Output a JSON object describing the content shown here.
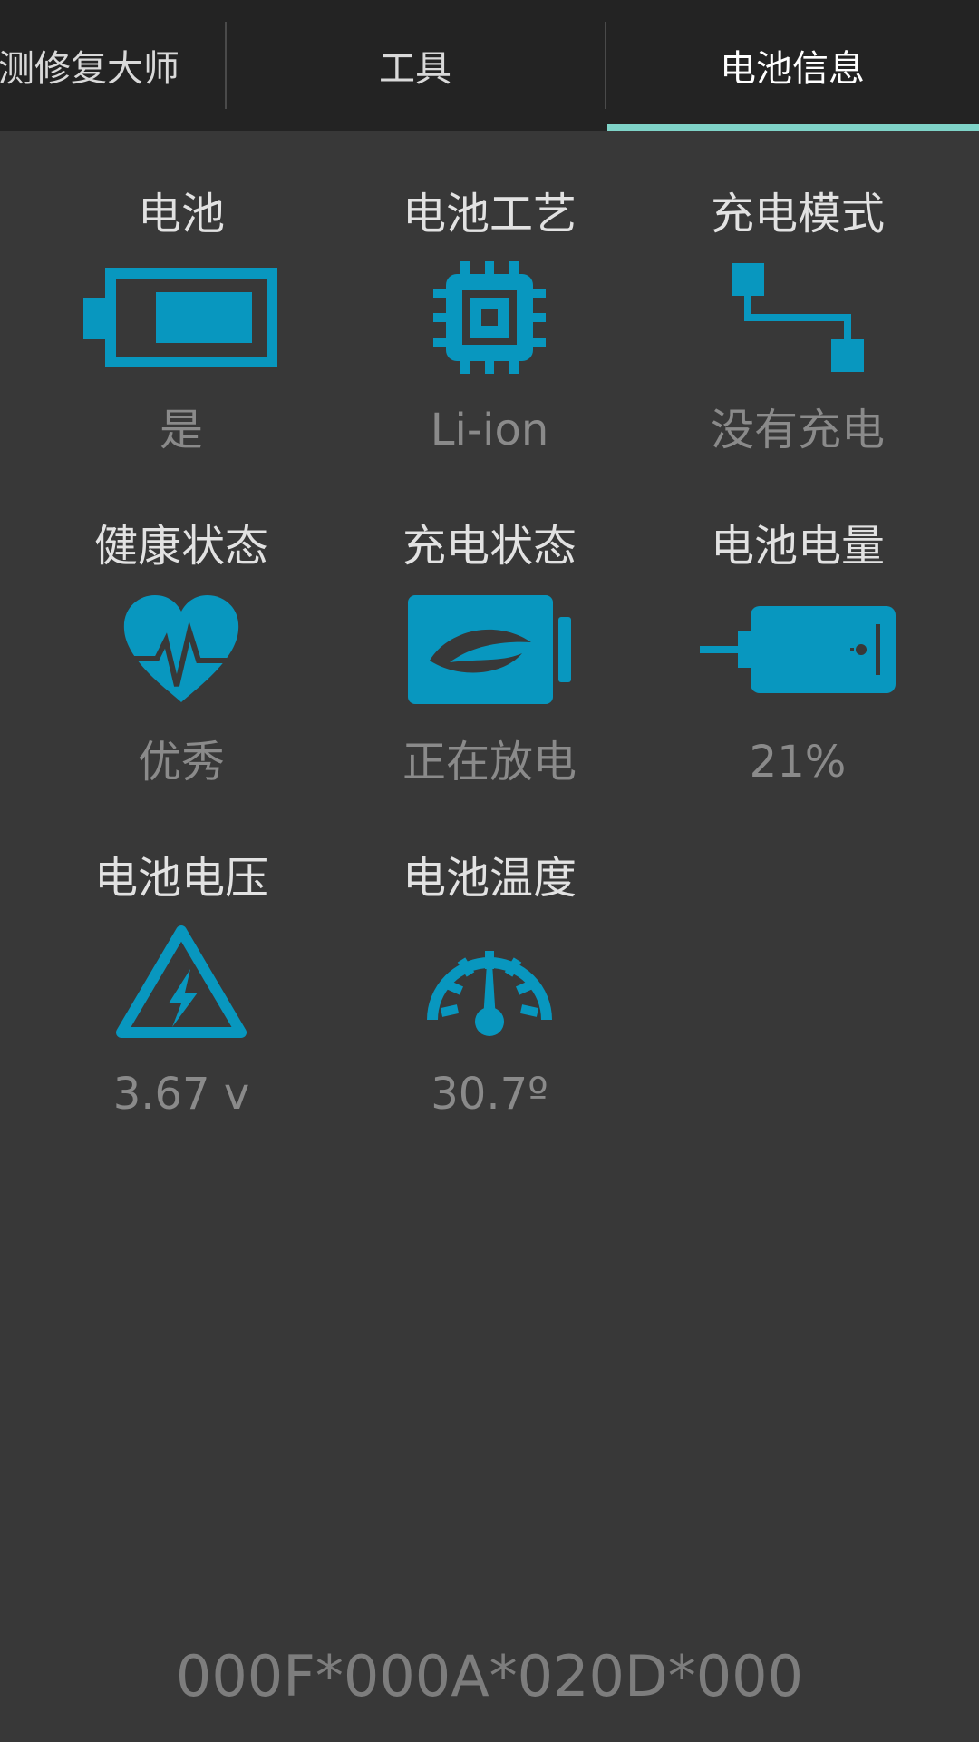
{
  "tabs": [
    {
      "label": "测修复大师",
      "active": false
    },
    {
      "label": "工具",
      "active": false
    },
    {
      "label": "电池信息",
      "active": true
    }
  ],
  "accent_color": "#0897bf",
  "indicator_color": "#7fd3c8",
  "items": [
    {
      "title": "电池",
      "icon": "battery-icon",
      "value": "是"
    },
    {
      "title": "电池工艺",
      "icon": "chip-icon",
      "value": "Li-ion"
    },
    {
      "title": "充电模式",
      "icon": "plug-connection-icon",
      "value": "没有充电"
    },
    {
      "title": "健康状态",
      "icon": "heart-pulse-icon",
      "value": "优秀"
    },
    {
      "title": "充电状态",
      "icon": "eco-battery-icon",
      "value": "正在放电"
    },
    {
      "title": "电池电量",
      "icon": "usb-device-icon",
      "value": "21%"
    },
    {
      "title": "电池电压",
      "icon": "voltage-warning-icon",
      "value": "3.67 v"
    },
    {
      "title": "电池温度",
      "icon": "gauge-icon",
      "value": "30.7º"
    }
  ],
  "footer": {
    "code": "000F*000A*020D*000"
  }
}
